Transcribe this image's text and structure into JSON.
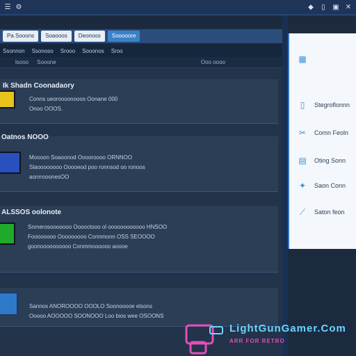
{
  "topbar": {
    "left_icons": [
      "list-icon",
      "settings-icon"
    ],
    "window_icons": [
      "bell-icon",
      "square-icon",
      "window-icon",
      "close-icon"
    ]
  },
  "tabs": [
    {
      "label": "Pa Sooons",
      "state": "active"
    },
    {
      "label": "Soaooos",
      "state": "active"
    },
    {
      "label": "Deonoos",
      "state": "active"
    },
    {
      "label": "Sooooore",
      "state": "active-blue"
    }
  ],
  "menubar": {
    "items": [
      "Ssonnon",
      "Ssonoso",
      "Srooo",
      "Sooonos",
      "Sroo"
    ]
  },
  "subbar": {
    "left_items": [
      "lsooo",
      "Sooone"
    ],
    "right_item": "Ooo oooo"
  },
  "cards": [
    {
      "title": "Ik Shadn Coonadaory",
      "lines": [
        "Conns ueoroooonooos Oonane 000",
        "Onoo OOOS."
      ],
      "thumb_color": "#e8c31a"
    },
    {
      "title": "Oatnos NOOO",
      "lines": [
        "Moooon Soaoonod Ooooroooo ORNNOO",
        "Slaoooooooo Ooooeod poo ronnsod oo ronoos",
        "aonrrooonesOO"
      ],
      "thumb_color": "#2a4fbf"
    },
    {
      "title": "ALSSOS oolonote",
      "lines": [
        "Snmerosooooooo Ooooctooo ol oooooooooooo HNSOO",
        "Foooooooo Ooooooooo Connmonn OSS SEOOOO",
        "goonoooooooooo Conmmoooooo aoooe"
      ],
      "thumb_color": "#1faa2a"
    },
    {
      "title": "",
      "lines": [
        "Sannos ANOROOOO OOOLO Soonooooe elsons",
        "Ooooo AOOOOO SOONOOO Loo bios wee OSOONS"
      ],
      "thumb_color": "#2f79c9"
    }
  ],
  "sidepanel": {
    "items": [
      {
        "icon": "grid-icon",
        "label": ""
      },
      {
        "icon": "bookmark-icon",
        "label": "Stegroflonnn"
      },
      {
        "icon": "tools-icon",
        "label": "Comn Feoln"
      },
      {
        "icon": "layers-icon",
        "label": "Oting Sonn"
      },
      {
        "icon": "puzzle-icon",
        "label": "Saon Conn"
      },
      {
        "icon": "edit-icon",
        "label": "Saton feon"
      }
    ]
  },
  "watermark": {
    "title": "LightGunGamer.Com",
    "subtitle": "ARR FOR RETRO"
  }
}
